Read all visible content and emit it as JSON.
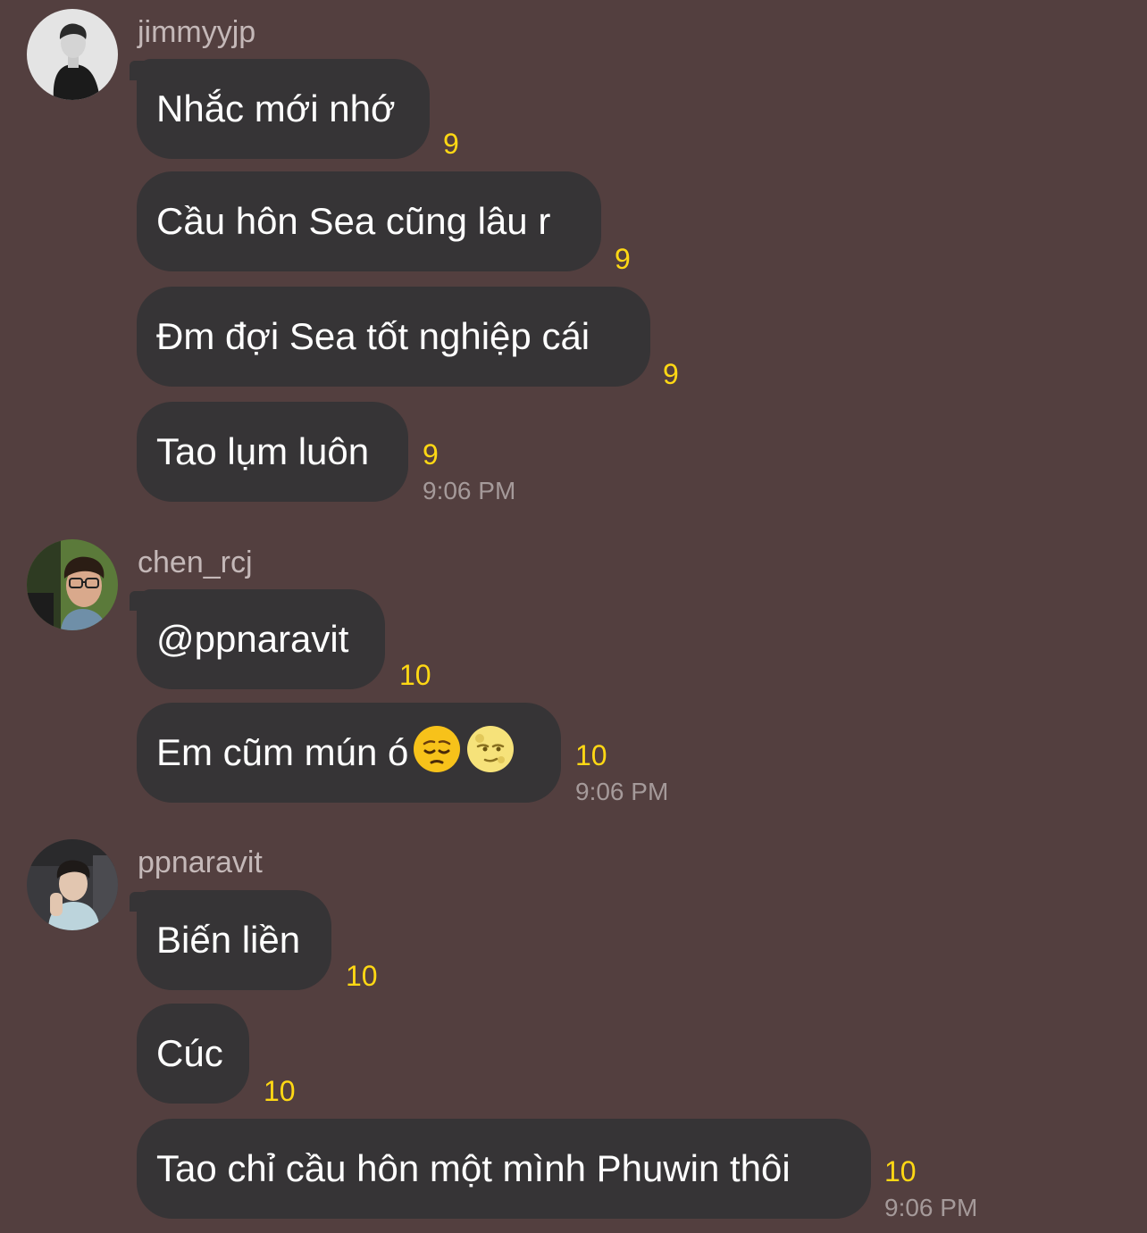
{
  "groups": [
    {
      "username": "jimmyyjp",
      "avatar_icon": "avatar-jimmyyjp",
      "messages": [
        {
          "text": "Nhắc mới nhớ",
          "count": "9"
        },
        {
          "text": "Cầu hôn Sea cũng lâu r",
          "count": "9"
        },
        {
          "text": "Đm đợi Sea tốt nghiệp cái",
          "count": "9"
        },
        {
          "text": "Tao lụm luôn",
          "count": "9"
        }
      ],
      "time": "9:06 PM"
    },
    {
      "username": "chen_rcj",
      "avatar_icon": "avatar-chen-rcj",
      "messages": [
        {
          "text": "@ppnaravit",
          "count": "10"
        },
        {
          "text": "Em cũm mún ó",
          "count": "10",
          "emojis": [
            "pensive-face-emoji",
            "full-moon-face-emoji"
          ]
        }
      ],
      "time": "9:06 PM"
    },
    {
      "username": "ppnaravit",
      "avatar_icon": "avatar-ppnaravit",
      "messages": [
        {
          "text": "Biến liền",
          "count": "10"
        },
        {
          "text": "Cúc",
          "count": "10"
        },
        {
          "text": "Tao chỉ cầu hôn một mình Phuwin thôi",
          "count": "10"
        }
      ],
      "time": "9:06 PM"
    }
  ],
  "colors": {
    "background": "#533f3f",
    "bubble": "#363436",
    "count": "#ffd814",
    "username": "#c4b8b8",
    "time": "#a59a9a"
  }
}
